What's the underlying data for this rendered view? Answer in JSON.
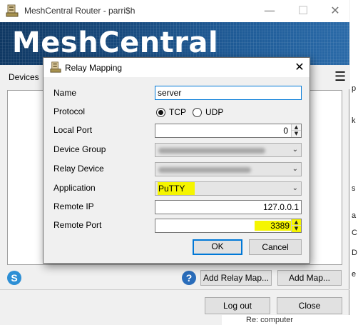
{
  "window": {
    "title": "MeshCentral Router - parri$h",
    "brand": "MeshCentral",
    "tab_devices": "Devices"
  },
  "footer": {
    "add_relay_map": "Add Relay Map...",
    "add_map": "Add Map...",
    "logout": "Log out",
    "close": "Close"
  },
  "background": {
    "right_letters": [
      "p",
      "k",
      "s",
      "a",
      "C",
      "D",
      "e"
    ],
    "status_text": "Re: computer"
  },
  "dialog": {
    "title": "Relay Mapping",
    "labels": {
      "name": "Name",
      "protocol": "Protocol",
      "local_port": "Local Port",
      "device_group": "Device Group",
      "relay_device": "Relay Device",
      "application": "Application",
      "remote_ip": "Remote IP",
      "remote_port": "Remote Port"
    },
    "values": {
      "name": "server",
      "local_port": "0",
      "application": "PuTTY",
      "remote_ip": "127.0.0.1",
      "remote_port": "3389"
    },
    "protocol_options": [
      "TCP",
      "UDP"
    ],
    "protocol_selected": "TCP",
    "ok": "OK",
    "cancel": "Cancel"
  },
  "colors": {
    "highlight": "#f5f500",
    "focus_border": "#0078d7",
    "banner": "#1a4f85"
  }
}
